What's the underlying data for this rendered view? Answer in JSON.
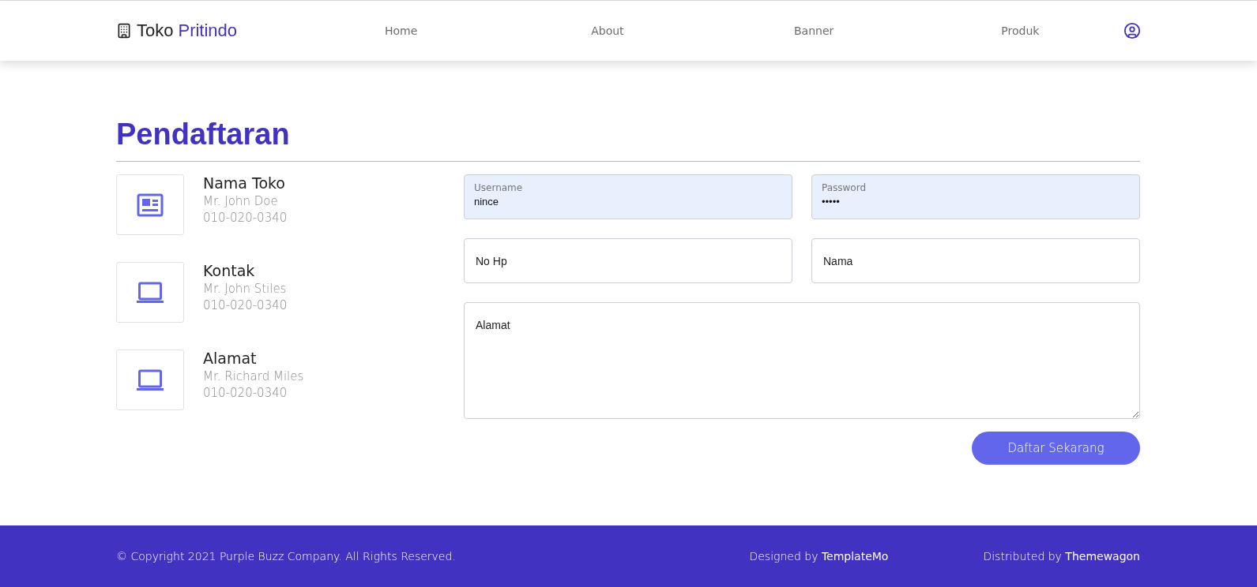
{
  "navbar": {
    "brand": {
      "first": "Toko",
      "second": "Pritindo"
    },
    "links": [
      {
        "label": "Home"
      },
      {
        "label": "About"
      },
      {
        "label": "Banner"
      },
      {
        "label": "Produk"
      }
    ]
  },
  "page_title": "Pendaftaran",
  "contacts": [
    {
      "kind": "newspaper",
      "title": "Nama Toko",
      "name": "Mr. John Doe",
      "phone": "010-020-0340"
    },
    {
      "kind": "laptop",
      "title": "Kontak",
      "name": "Mr. John Stiles",
      "phone": "010-020-0340"
    },
    {
      "kind": "laptop",
      "title": "Alamat",
      "name": "Mr. Richard Miles",
      "phone": "010-020-0340"
    }
  ],
  "form": {
    "fields": [
      {
        "kind": "filled",
        "label": "Username",
        "value": "nince"
      },
      {
        "kind": "filled",
        "label": "Password",
        "value": "•••••"
      },
      {
        "kind": "empty",
        "placeholder": "No Hp"
      },
      {
        "kind": "empty",
        "placeholder": "Nama"
      },
      {
        "kind": "textarea",
        "placeholder": "Alamat"
      }
    ],
    "submit": "Daftar Sekarang"
  },
  "footer": {
    "copyright": "© Copyright 2021 Purple Buzz Company. All Rights Reserved.",
    "designed": "Designed by **TemplateMo**",
    "distributed": "Distributed by **Themewagon**"
  }
}
